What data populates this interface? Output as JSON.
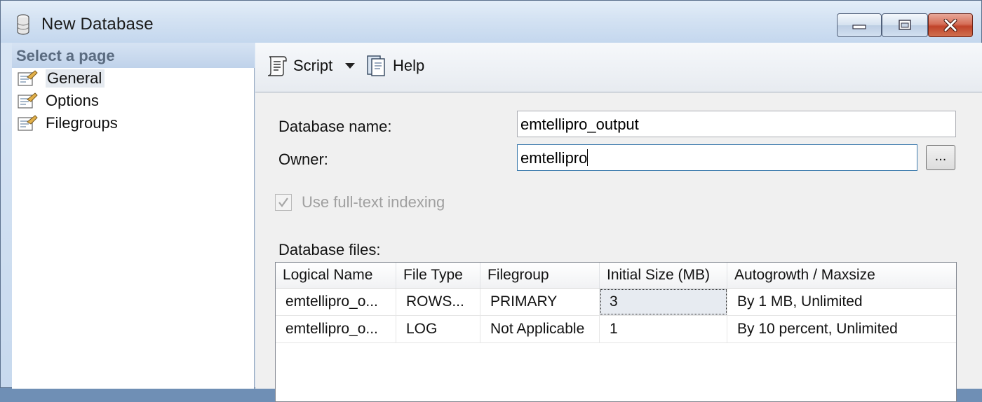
{
  "window": {
    "title": "New Database"
  },
  "select_page": {
    "header": "Select a page",
    "items": [
      {
        "label": "General",
        "selected": true
      },
      {
        "label": "Options",
        "selected": false
      },
      {
        "label": "Filegroups",
        "selected": false
      }
    ]
  },
  "toolbar": {
    "script_label": "Script",
    "help_label": "Help"
  },
  "form": {
    "database_name_label": "Database name:",
    "database_name_value": "emtellipro_output",
    "owner_label": "Owner:",
    "owner_value": "emtellipro",
    "owner_browse_label": "...",
    "fulltext_label": "Use full-text indexing",
    "fulltext_checked": true,
    "fulltext_enabled": false,
    "database_files_label": "Database files:"
  },
  "files_grid": {
    "columns": [
      "Logical Name",
      "File Type",
      "Filegroup",
      "Initial Size (MB)",
      "Autogrowth / Maxsize"
    ],
    "rows": [
      [
        "emtellipro_o...",
        "ROWS...",
        "PRIMARY",
        "3",
        "By 1 MB, Unlimited"
      ],
      [
        "emtellipro_o...",
        "LOG",
        "Not Applicable",
        "1",
        "By 10 percent, Unlimited"
      ]
    ]
  },
  "colors": {
    "title_bar": "#d2e1f2",
    "close_button": "#c0432a",
    "panel_background": "#f0f0f0"
  }
}
